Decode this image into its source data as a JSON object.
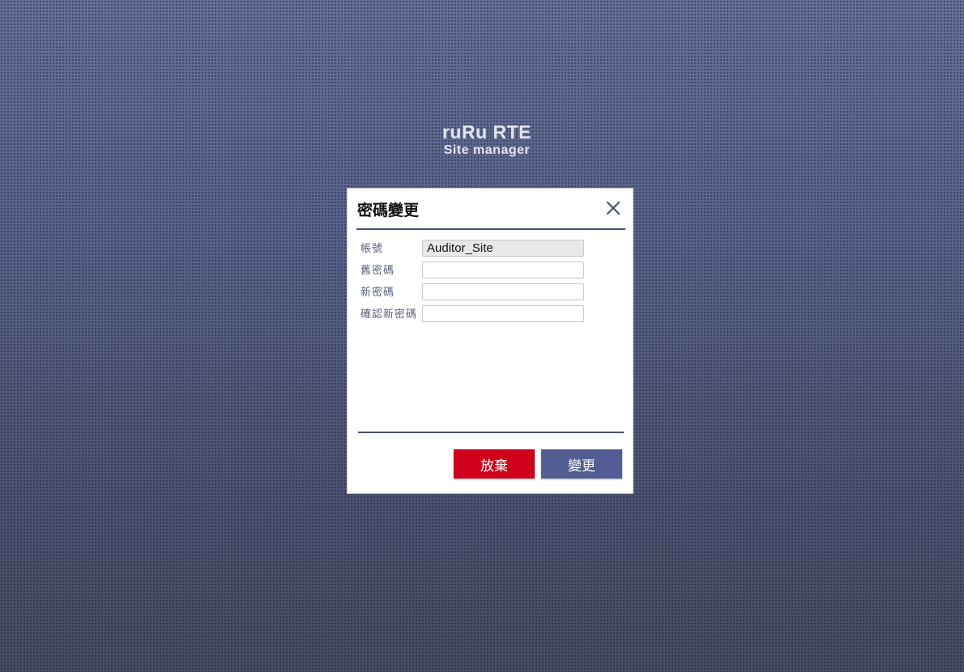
{
  "brand": {
    "title": "ruRu RTE",
    "subtitle": "Site manager"
  },
  "dialog": {
    "title": "密碼變更",
    "close_icon": "close-icon",
    "fields": [
      {
        "label": "帳號",
        "value": "Auditor_Site",
        "readonly": true
      },
      {
        "label": "舊密碼",
        "value": "",
        "readonly": false
      },
      {
        "label": "新密碼",
        "value": "",
        "readonly": false
      },
      {
        "label": "確認新密碼",
        "value": "",
        "readonly": false
      }
    ],
    "buttons": {
      "cancel_label": "放棄",
      "change_label": "變更"
    }
  },
  "colors": {
    "header_rule": "#4a5280",
    "cancel_button": "#d0021b",
    "change_button": "#535d93",
    "background": "#5f6890"
  }
}
